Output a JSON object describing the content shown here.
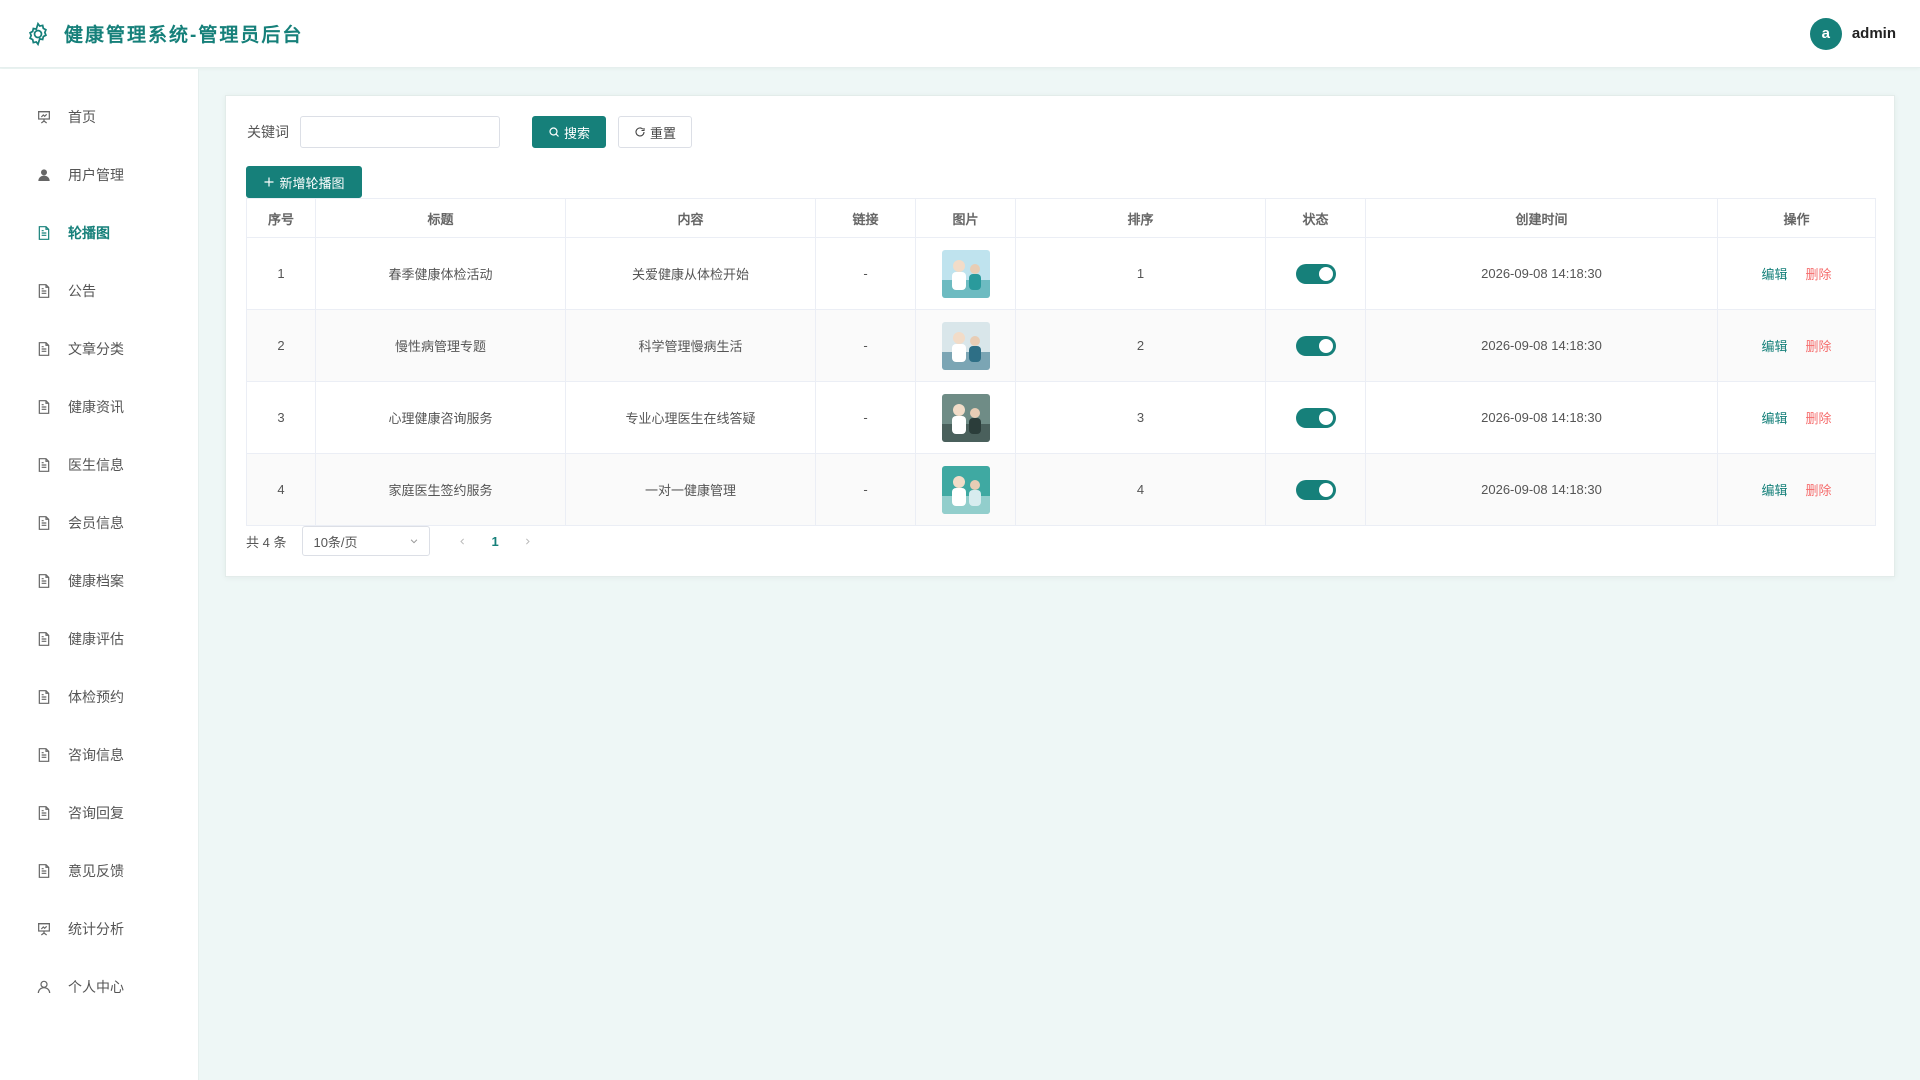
{
  "app": {
    "title": "健康管理系统-管理员后台",
    "brand_icon": "gear-icon",
    "accent_color": "#16807a",
    "danger_color": "#f56c6c"
  },
  "user": {
    "avatar_letter": "a",
    "name": "admin"
  },
  "sidebar": {
    "items": [
      {
        "label": "首页",
        "icon": "presentation-icon",
        "active": false
      },
      {
        "label": "用户管理",
        "icon": "user-filled-icon",
        "active": false
      },
      {
        "label": "轮播图",
        "icon": "document-icon",
        "active": true
      },
      {
        "label": "公告",
        "icon": "document-icon",
        "active": false
      },
      {
        "label": "文章分类",
        "icon": "document-icon",
        "active": false
      },
      {
        "label": "健康资讯",
        "icon": "document-icon",
        "active": false
      },
      {
        "label": "医生信息",
        "icon": "document-icon",
        "active": false
      },
      {
        "label": "会员信息",
        "icon": "document-icon",
        "active": false
      },
      {
        "label": "健康档案",
        "icon": "document-icon",
        "active": false
      },
      {
        "label": "健康评估",
        "icon": "document-icon",
        "active": false
      },
      {
        "label": "体检预约",
        "icon": "document-icon",
        "active": false
      },
      {
        "label": "咨询信息",
        "icon": "document-icon",
        "active": false
      },
      {
        "label": "咨询回复",
        "icon": "document-icon",
        "active": false
      },
      {
        "label": "意见反馈",
        "icon": "document-icon",
        "active": false
      },
      {
        "label": "统计分析",
        "icon": "presentation-icon",
        "active": false
      },
      {
        "label": "个人中心",
        "icon": "user-outline-icon",
        "active": false
      }
    ]
  },
  "search": {
    "keyword_label": "关键词",
    "keyword_value": "",
    "keyword_placeholder": "",
    "search_label": "搜索",
    "reset_label": "重置",
    "add_label": "新增轮播图"
  },
  "table": {
    "columns": [
      "序号",
      "标题",
      "内容",
      "链接",
      "图片",
      "排序",
      "状态",
      "创建时间",
      "操作"
    ],
    "rows": [
      {
        "index": "1",
        "title": "春季健康体检活动",
        "content": "关爱健康从体检开始",
        "link": "-",
        "sort": "1",
        "enabled": true,
        "created": "2026-09-08 14:18:30",
        "thumb": [
          "#bfe3ee",
          "#2a9a9c"
        ]
      },
      {
        "index": "2",
        "title": "慢性病管理专题",
        "content": "科学管理慢病生活",
        "link": "-",
        "sort": "2",
        "enabled": true,
        "created": "2026-09-08 14:18:30",
        "thumb": [
          "#d9e6ea",
          "#2e6f86"
        ]
      },
      {
        "index": "3",
        "title": "心理健康咨询服务",
        "content": "专业心理医生在线答疑",
        "link": "-",
        "sort": "3",
        "enabled": true,
        "created": "2026-09-08 14:18:30",
        "thumb": [
          "#6f8c86",
          "#2b3d3a"
        ]
      },
      {
        "index": "4",
        "title": "家庭医生签约服务",
        "content": "一对一健康管理",
        "link": "-",
        "sort": "4",
        "enabled": true,
        "created": "2026-09-08 14:18:30",
        "thumb": [
          "#3fa9a2",
          "#d7ecef"
        ]
      }
    ],
    "edit_label": "编辑",
    "delete_label": "删除"
  },
  "pagination": {
    "total_text": "共 4 条",
    "page_size": "10条/页",
    "current_page": "1"
  }
}
